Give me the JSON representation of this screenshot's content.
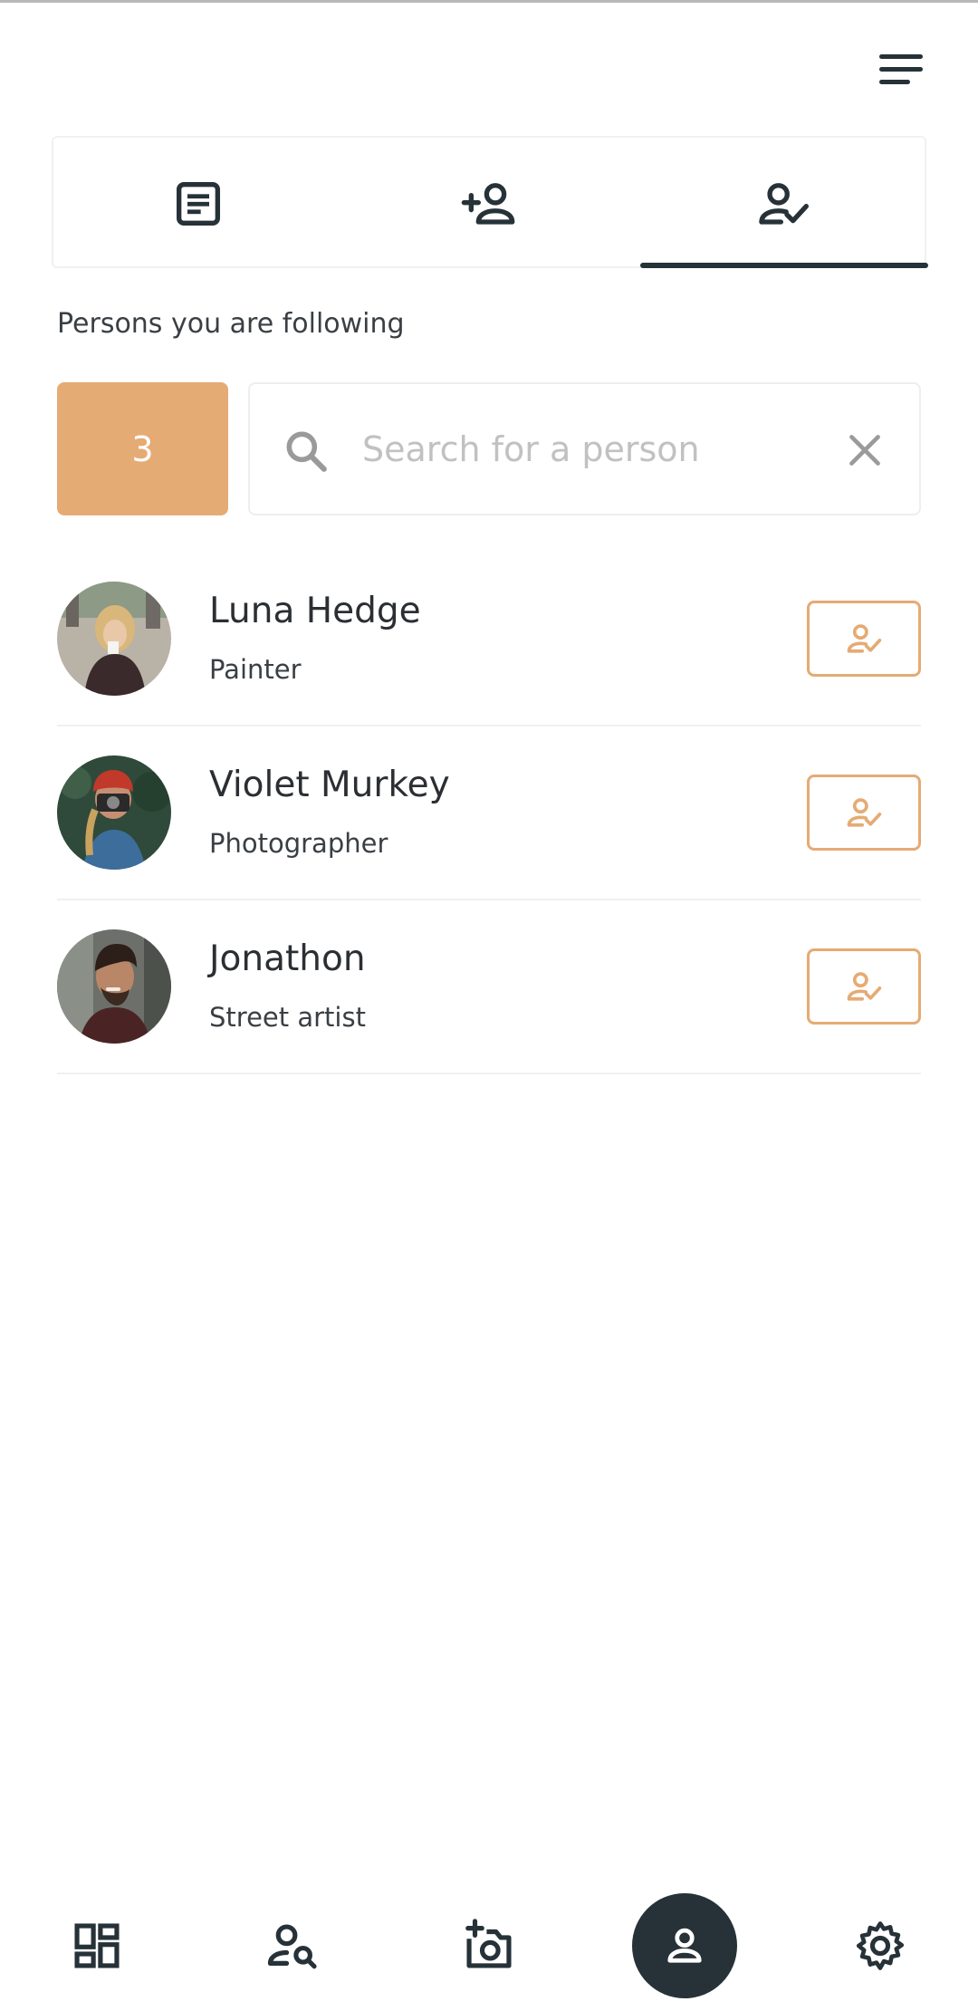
{
  "header": {
    "menu_icon": "menu-icon"
  },
  "tabs": [
    {
      "id": "posts",
      "icon": "article-icon",
      "active": false
    },
    {
      "id": "add-person",
      "icon": "person-add-icon",
      "active": false
    },
    {
      "id": "following",
      "icon": "person-check-icon",
      "active": true
    }
  ],
  "section": {
    "label": "Persons you are following"
  },
  "following_count": "3",
  "search": {
    "placeholder": "Search for a person",
    "value": ""
  },
  "people": [
    {
      "name": "Luna Hedge",
      "role": "Painter"
    },
    {
      "name": "Violet Murkey",
      "role": "Photographer"
    },
    {
      "name": "Jonathon",
      "role": "Street artist"
    }
  ],
  "bottom_nav": [
    {
      "id": "dashboard",
      "icon": "dashboard-icon",
      "active": false
    },
    {
      "id": "search-people",
      "icon": "person-search-icon",
      "active": false
    },
    {
      "id": "add-photo",
      "icon": "add-camera-icon",
      "active": false
    },
    {
      "id": "profile",
      "icon": "person-icon",
      "active": true
    },
    {
      "id": "settings",
      "icon": "gear-icon",
      "active": false
    }
  ],
  "colors": {
    "accent": "#e5ab74",
    "dark": "#263238",
    "text": "#2b2f33"
  }
}
